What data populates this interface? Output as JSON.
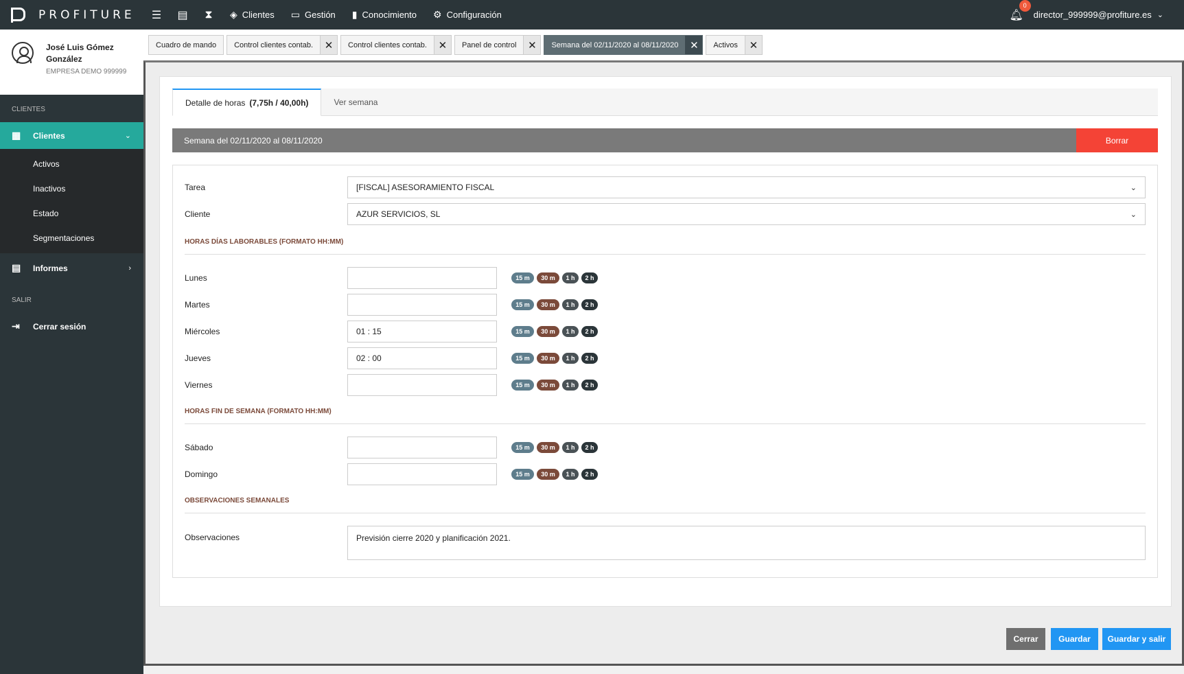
{
  "topbar": {
    "logo_text": "PROFITURE",
    "nav": [
      {
        "label": "Clientes",
        "icon": "layers-icon"
      },
      {
        "label": "Gestión",
        "icon": "monitor-icon"
      },
      {
        "label": "Conocimiento",
        "icon": "book-icon"
      },
      {
        "label": "Configuración",
        "icon": "gear-icon"
      }
    ],
    "notifications_count": "0",
    "user_email": "director_999999@profiture.es"
  },
  "sidebar": {
    "user_name": "José Luis Gómez González",
    "company": "EMPRESA DEMO 999999",
    "section_clientes": "CLIENTES",
    "clientes_label": "Clientes",
    "sub_items": [
      "Activos",
      "Inactivos",
      "Estado",
      "Segmentaciones"
    ],
    "informes_label": "Informes",
    "section_salir": "SALIR",
    "logout_label": "Cerrar sesión"
  },
  "tabs": [
    {
      "label": "Cuadro de mando",
      "closable": false
    },
    {
      "label": "Control clientes contab.",
      "closable": true
    },
    {
      "label": "Control clientes contab.",
      "closable": true
    },
    {
      "label": "Panel de control",
      "closable": true
    },
    {
      "label": "Semana del 02/11/2020 al 08/11/2020",
      "closable": true,
      "active": true
    },
    {
      "label": "Activos",
      "closable": true
    }
  ],
  "inner_tabs": {
    "detail_label": "Detalle de horas",
    "detail_hours": "(7,75h / 40,00h)",
    "week_label": "Ver semana"
  },
  "week_bar": {
    "title": "Semana del 02/11/2020 al 08/11/2020",
    "delete_label": "Borrar"
  },
  "form": {
    "tarea_label": "Tarea",
    "tarea_value": "[FISCAL] ASESORAMIENTO FISCAL",
    "cliente_label": "Cliente",
    "cliente_value": "AZUR SERVICIOS, SL",
    "weekday_section": "HORAS DÍAS LABORABLES (FORMATO HH:MM)",
    "weekend_section": "HORAS FIN DE SEMANA (FORMATO HH:MM)",
    "obs_section": "OBSERVACIONES SEMANALES",
    "days": [
      {
        "label": "Lunes",
        "value": ""
      },
      {
        "label": "Martes",
        "value": ""
      },
      {
        "label": "Miércoles",
        "value": "01 : 15"
      },
      {
        "label": "Jueves",
        "value": "02 : 00"
      },
      {
        "label": "Viernes",
        "value": ""
      },
      {
        "label": "Sábado",
        "value": ""
      },
      {
        "label": "Domingo",
        "value": ""
      }
    ],
    "quick_buttons": [
      "15 m",
      "30 m",
      "1 h",
      "2 h"
    ],
    "obs_label": "Observaciones",
    "obs_value": "Previsión cierre 2020 y planificación 2021."
  },
  "buttons": {
    "close": "Cerrar",
    "save": "Guardar",
    "save_exit": "Guardar y salir"
  },
  "colors": {
    "topbar": "#2b3539",
    "accent": "#25a99c",
    "primary": "#2196f3",
    "danger": "#f44336"
  }
}
